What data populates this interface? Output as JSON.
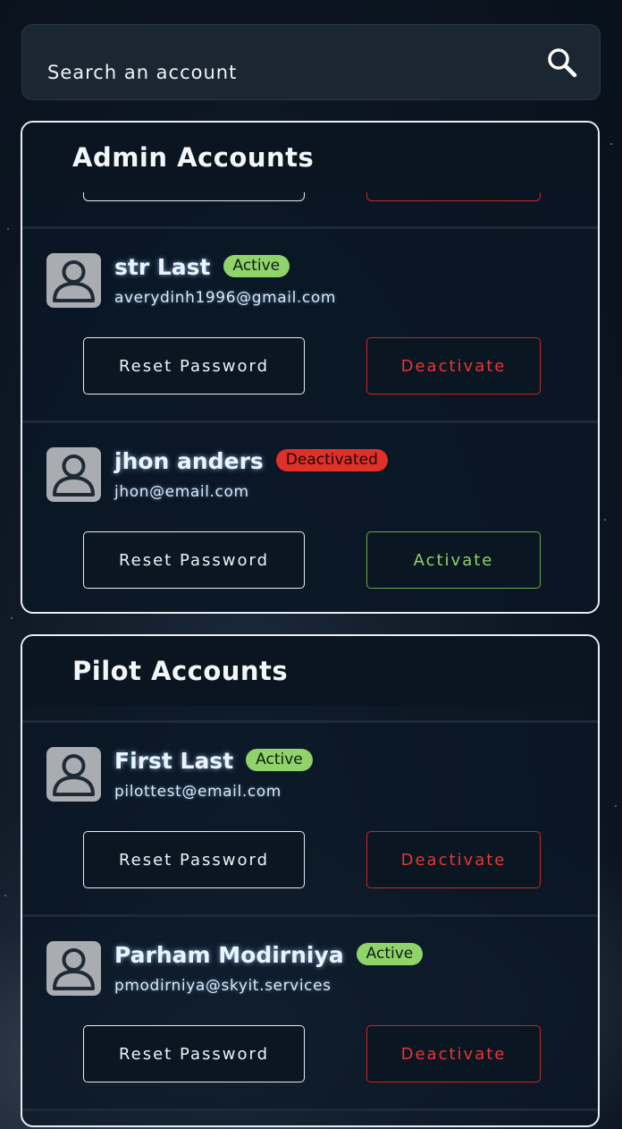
{
  "search": {
    "placeholder": "Search an account",
    "icon": "search-icon"
  },
  "admin": {
    "title": "Admin Accounts",
    "accounts": [
      {
        "name": "str Last",
        "status": "Active",
        "email": "averydinh1996@gmail.com",
        "reset_label": "Reset Password",
        "action_label": "Deactivate"
      },
      {
        "name": "jhon anders",
        "status": "Deactivated",
        "email": "jhon@email.com",
        "reset_label": "Reset Password",
        "action_label": "Activate"
      }
    ]
  },
  "pilot": {
    "title": "Pilot Accounts",
    "accounts": [
      {
        "name": "First Last",
        "status": "Active",
        "email": "pilottest@email.com",
        "reset_label": "Reset Password",
        "action_label": "Deactivate"
      },
      {
        "name": "Parham Modirniya",
        "status": "Active",
        "email": "pmodirniya@skyit.services",
        "reset_label": "Reset Password",
        "action_label": "Deactivate"
      }
    ]
  },
  "colors": {
    "active": "#8fd36a",
    "deactivated": "#e0302a",
    "panel_border": "#e9eef4"
  }
}
